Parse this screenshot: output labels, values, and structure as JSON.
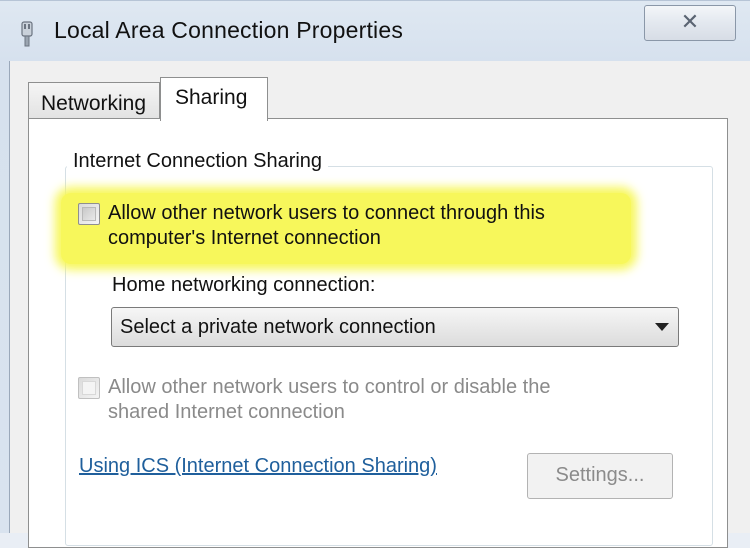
{
  "window": {
    "title": "Local Area Connection Properties",
    "close_glyph": "✕"
  },
  "tabs": [
    {
      "label": "Networking",
      "selected": false
    },
    {
      "label": "Sharing",
      "selected": true
    }
  ],
  "sharing": {
    "group_title": "Internet Connection Sharing",
    "allow_connect": {
      "label_line1": "Allow other network users to connect through this",
      "label_line2": "computer's Internet connection",
      "checked": false
    },
    "home_networking_label": "Home networking connection:",
    "home_networking_select": "Select a private network connection",
    "allow_control": {
      "label_line1": "Allow other network users to control or disable the",
      "label_line2": "shared Internet connection",
      "checked": false,
      "enabled": false
    },
    "help_link": "Using ICS (Internet Connection Sharing)",
    "settings_button": "Settings..."
  },
  "colors": {
    "highlight": "#f7f75b",
    "link": "#1f5f9c",
    "disabled_text": "#8a8a8a"
  },
  "icons": {
    "title_icon": "network-adapter-icon",
    "dropdown": "chevron-down-icon"
  }
}
